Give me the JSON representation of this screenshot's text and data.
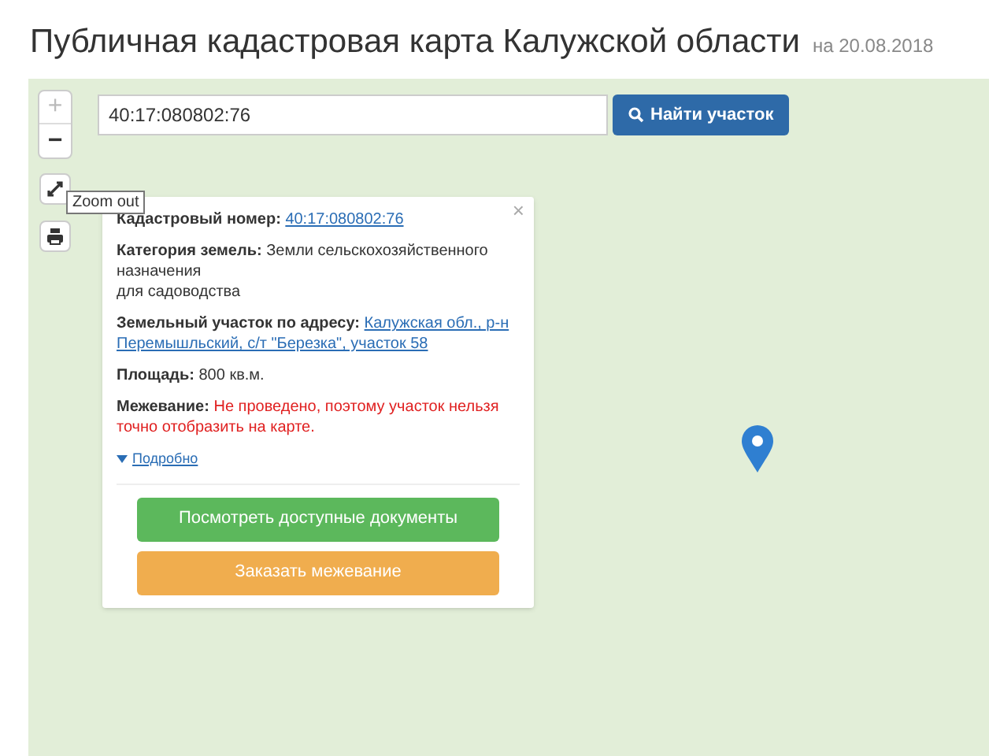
{
  "header": {
    "title": "Публичная кадастровая карта Калужской области",
    "date": "на 20.08.2018"
  },
  "map_controls": {
    "zoom_in": {
      "label": "+",
      "disabled": true
    },
    "zoom_out": {
      "label": "−",
      "disabled": false
    },
    "tooltip": "Zoom out"
  },
  "search": {
    "value": "40:17:080802:76",
    "button": "Найти участок"
  },
  "popup": {
    "close": "×",
    "fields": [
      {
        "label": "Кадастровый номер:",
        "value": [
          "40:17:080802:76"
        ],
        "kind": "link"
      },
      {
        "label": "Категория земель:",
        "value": "Земли сельскохозяйственного назначения\nдля садоводства",
        "kind": "text"
      },
      {
        "label": "Земельный участок по адресу:",
        "value": [
          "Калужская обл., р-н",
          "Перемышльский, с/т \"Березка\", участок 58"
        ],
        "kind": "link"
      },
      {
        "label": "Площадь:",
        "value": "800 кв.м.",
        "kind": "text"
      },
      {
        "label": "Межевание:",
        "value": "Не проведено, поэтому участок нельзя точно отобразить на карте.",
        "kind": "warning"
      }
    ],
    "more_link": "Подробно",
    "buttons": [
      {
        "label": "Посмотреть доступные документы",
        "color": "#5cb85c"
      },
      {
        "label": "Заказать межевание",
        "color": "#f0ad4e"
      }
    ]
  }
}
